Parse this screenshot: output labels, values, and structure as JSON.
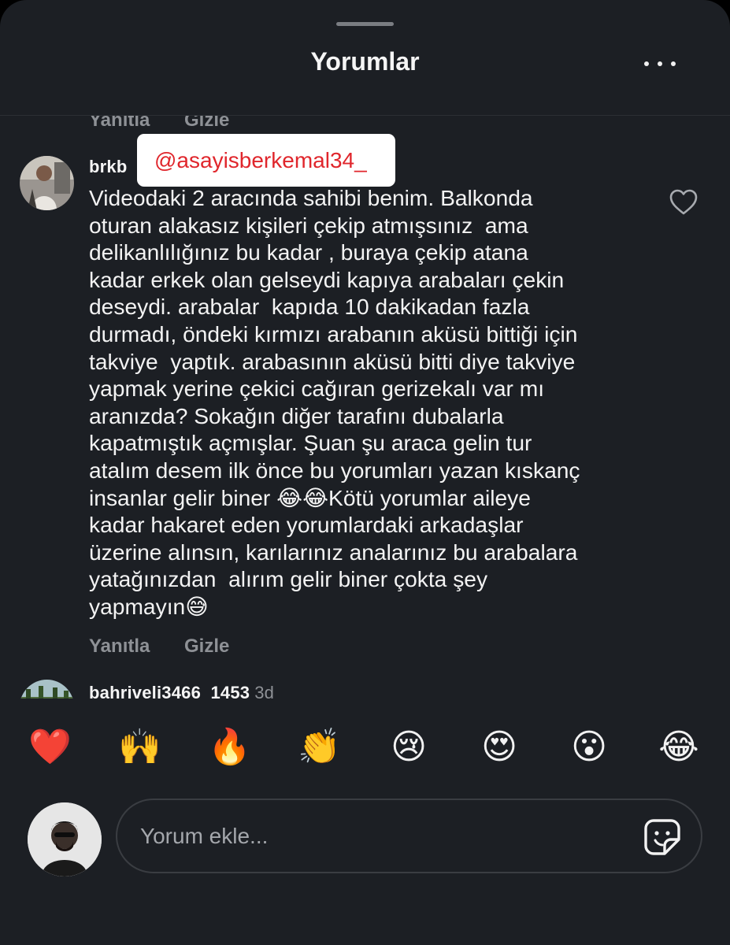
{
  "header": {
    "title": "Yorumlar",
    "more_icon": "more-horizontal-icon"
  },
  "previous_comment": {
    "reply_label": "Yanıtla",
    "hide_label": "Gizle"
  },
  "main_comment": {
    "username": "brkb",
    "mention_overlay": "@asayisberkemal34_",
    "text": "Videodaki 2 aracında sahibi benim. Balkonda\noturan alakasız kişileri çekip atmışsınız  ama\ndelikanlılığınız bu kadar , buraya çekip atana\nkadar erkek olan gelseydi kapıya arabaları çekin\ndeseydi. arabalar  kapıda 10 dakikadan fazla\ndurmadı, öndeki kırmızı arabanın aküsü bittiği için\ntakviye  yaptık. arabasının aküsü bitti diye takviye\nyapmak yerine çekici cağıran gerizekalı var mı\naranızda? Sokağın diğer tarafını dubalarla\nkapatmıştık açmışlar. Şuan şu araca gelin tur\natalım desem ilk önce bu yorumları yazan kıskanç\ninsanlar gelir biner 😂😂Kötü yorumlar aileye\nkadar hakaret eden yorumlardaki arkadaşlar\nüzerine alınsın, karılarınız analarınız bu arabalara\nyatağınızdan  alırım gelir biner çokta şey\nyapmayın😅",
    "reply_label": "Yanıtla",
    "hide_label": "Gizle",
    "like_icon": "heart-outline-icon"
  },
  "next_comment": {
    "username": "bahriveli3466_1453",
    "time": "3d"
  },
  "quick_reactions": [
    "❤️",
    "🙌",
    "🔥",
    "👏",
    "😢",
    "😍",
    "😮",
    "😂"
  ],
  "composer": {
    "placeholder": "Yorum ekle...",
    "sticker_icon": "sticker-icon"
  },
  "colors": {
    "background": "#1c1f24",
    "text": "#f3f3f3",
    "secondary_text": "#8e9196",
    "mention_text": "#e0262c",
    "mention_background": "#ffffff"
  }
}
